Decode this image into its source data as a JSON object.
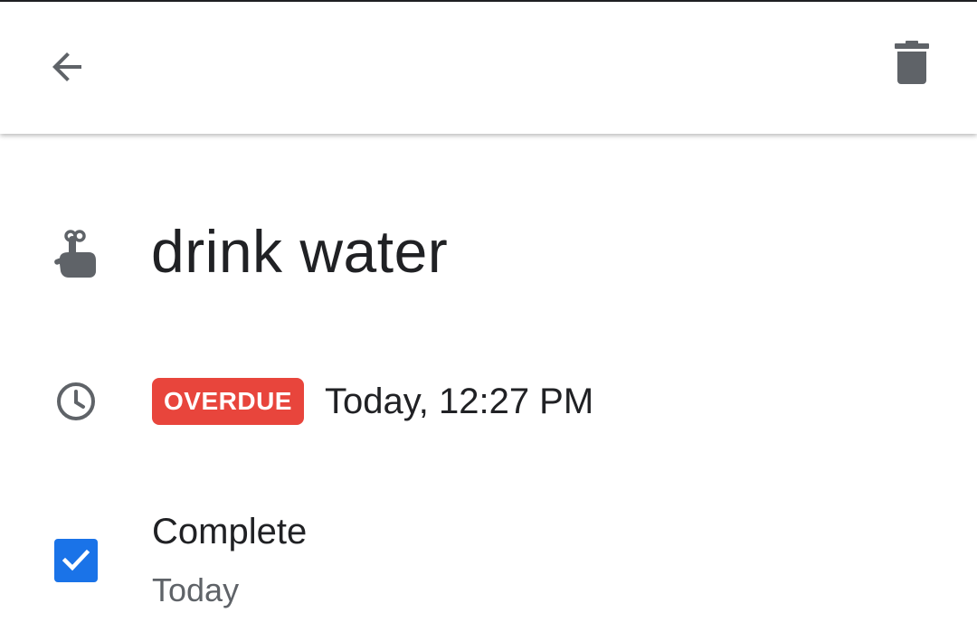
{
  "app_bar": {
    "back_icon": "arrow-back-icon",
    "delete_icon": "trash-icon"
  },
  "task": {
    "title": "drink water",
    "title_icon": "finger-string-reminder-icon"
  },
  "due": {
    "icon": "clock-icon",
    "badge": "OVERDUE",
    "badge_color": "#e8453c",
    "text": "Today, 12:27 PM"
  },
  "completion": {
    "checked": true,
    "checkbox_color": "#1a73e8",
    "label": "Complete",
    "subtext": "Today"
  }
}
